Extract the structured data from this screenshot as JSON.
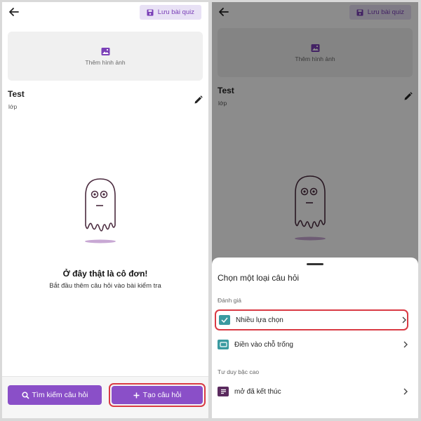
{
  "screen_left": {
    "save_label": "Lưu bài quiz",
    "add_image_label": "Thêm hình ảnh",
    "quiz_title": "Test",
    "quiz_class": "lớp",
    "empty_title": "Ở đây thật là cô đơn!",
    "empty_subtitle": "Bắt đầu thêm câu hỏi vào bài kiểm tra",
    "search_button": "Tìm kiếm câu hỏi",
    "create_button": "Tạo câu hỏi"
  },
  "screen_right": {
    "save_label": "Lưu bài quiz",
    "add_image_label": "Thêm hình ảnh",
    "quiz_title": "Test",
    "quiz_class": "lớp",
    "sheet": {
      "title": "Chọn một loại câu hỏi",
      "section_assessment": "Đánh giá",
      "section_higher_order": "Tư duy bậc cao",
      "options": [
        {
          "label": "Nhiều lựa chọn",
          "icon": "checkbox-icon",
          "color": "#3a9aa0"
        },
        {
          "label": "Điền vào chỗ trống",
          "icon": "blank-field-icon",
          "color": "#3a9aa0"
        },
        {
          "label": "mở đã kết thúc",
          "icon": "open-ended-icon",
          "color": "#5a2a5e"
        }
      ]
    }
  },
  "colors": {
    "primary": "#8a4fc8",
    "highlight": "#d93a44",
    "save_bg": "#e8e1f5"
  }
}
